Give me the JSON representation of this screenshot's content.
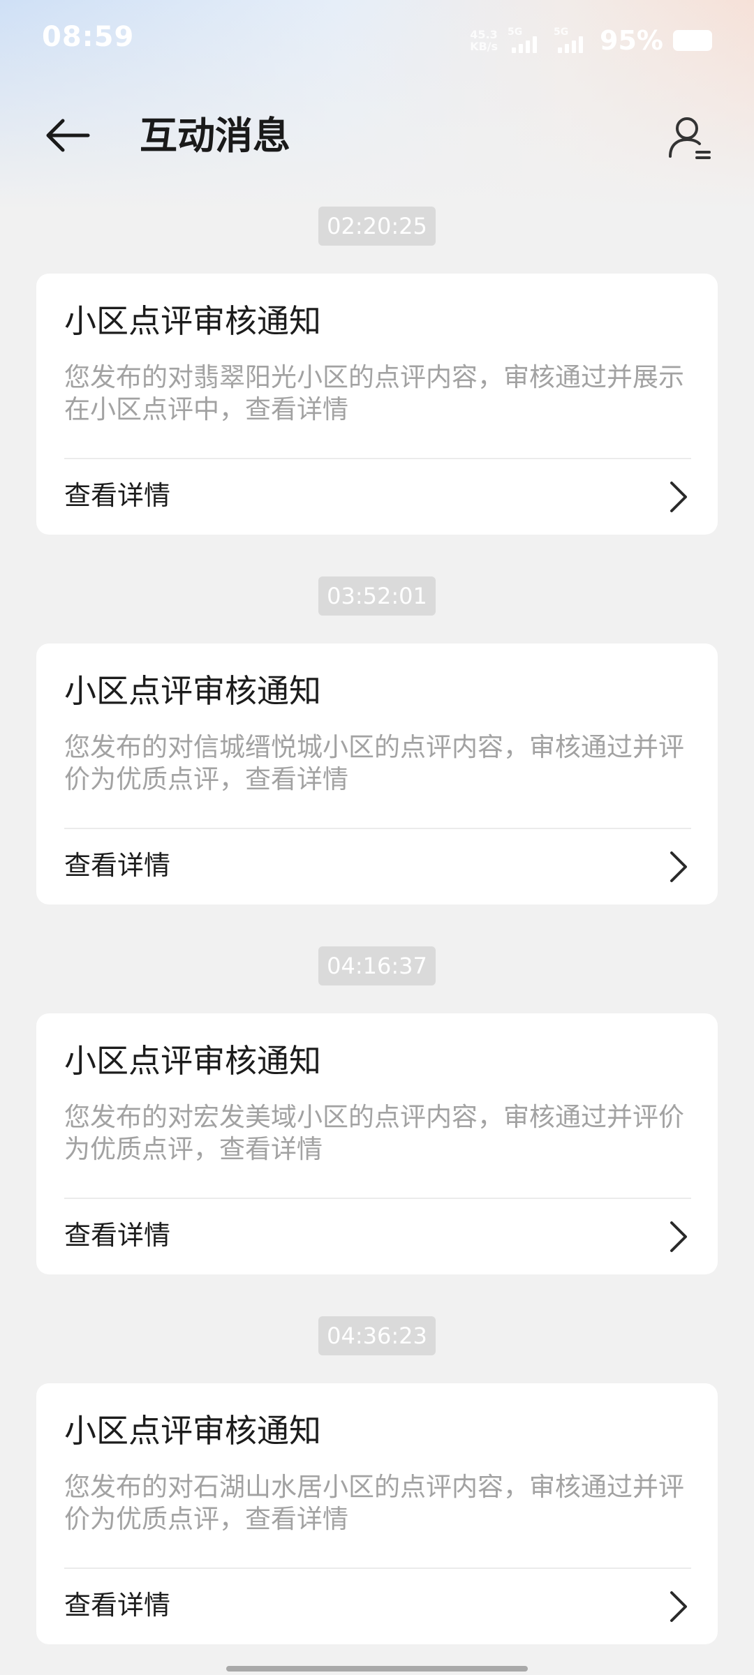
{
  "status_bar": {
    "time": "08:59",
    "net_speed_value": "45.3",
    "net_speed_unit": "KB/s",
    "sim1_label": "5G",
    "sim2_label": "5G",
    "battery_percent": "95%"
  },
  "header": {
    "title": "互动消息",
    "back_icon": "arrow-left-icon",
    "profile_icon": "user-list-icon"
  },
  "messages": [
    {
      "time": "02:20:25",
      "title": "小区点评审核通知",
      "body": "您发布的对翡翠阳光小区的点评内容，审核通过并展示在小区点评中，查看详情",
      "link_label": "查看详情"
    },
    {
      "time": "03:52:01",
      "title": "小区点评审核通知",
      "body": "您发布的对信城缙悦城小区的点评内容，审核通过并评价为优质点评，查看详情",
      "link_label": "查看详情"
    },
    {
      "time": "04:16:37",
      "title": "小区点评审核通知",
      "body": "您发布的对宏发美域小区的点评内容，审核通过并评价为优质点评，查看详情",
      "link_label": "查看详情"
    },
    {
      "time": "04:36:23",
      "title": "小区点评审核通知",
      "body": "您发布的对石湖山水居小区的点评内容，审核通过并评价为优质点评，查看详情",
      "link_label": "查看详情"
    }
  ]
}
